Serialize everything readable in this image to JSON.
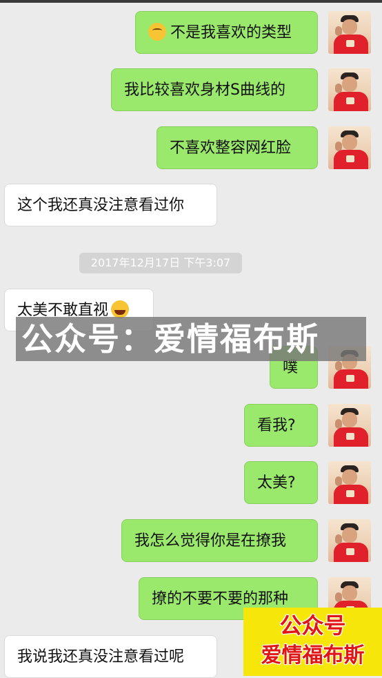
{
  "messages": [
    {
      "side": "right",
      "text": "不是我喜欢的类型",
      "emoji_before": "slightly-smiling-face-icon"
    },
    {
      "side": "right",
      "text": "我比较喜欢身材S曲线的"
    },
    {
      "side": "right",
      "text": "不喜欢整容网红脸"
    },
    {
      "side": "left",
      "text": "这个我还真没注意看过你"
    },
    {
      "side": "left",
      "text": "太美不敢直视",
      "emoji_after": "tears-of-joy-icon"
    },
    {
      "side": "right",
      "text": "噗"
    },
    {
      "side": "right",
      "text": "看我?"
    },
    {
      "side": "right",
      "text": "太美?"
    },
    {
      "side": "right",
      "text": "我怎么觉得你是在撩我"
    },
    {
      "side": "right",
      "text": "撩的不要不要的那种"
    },
    {
      "side": "left",
      "text": "我说我还真没注意看过呢"
    }
  ],
  "timestamp": "2017年12月17日 下午3:07",
  "watermark_banner": "公众号：爱情福布斯",
  "corner_badge": {
    "line1": "公众号",
    "line2": "爱情福布斯"
  },
  "colors": {
    "my_bubble": "#9ae86c",
    "their_bubble": "#ffffff",
    "background": "#ebebeb",
    "badge_bg": "#f7e60a",
    "badge_text": "#e01515"
  }
}
